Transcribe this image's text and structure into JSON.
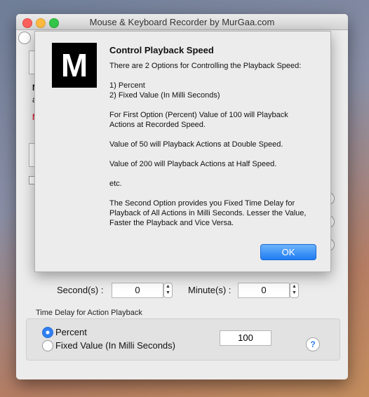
{
  "window": {
    "title": "Mouse & Keyboard Recorder by MurGaa.com"
  },
  "background_fragments": {
    "letter_n": "N",
    "letter_a": "a",
    "letter_n_red": "N"
  },
  "time_row": {
    "seconds_label": "Second(s) :",
    "seconds_value": "0",
    "minutes_label": "Minute(s) :",
    "minutes_value": "0"
  },
  "playback_group": {
    "label": "Time Delay for Action Playback",
    "option_percent": "Percent",
    "option_fixed": "Fixed Value (In Milli Seconds)",
    "selected": "Percent",
    "value": "100",
    "help_label": "?"
  },
  "dialog": {
    "logo_letter": "M",
    "title": "Control Playback Speed",
    "paragraphs": [
      "There are 2 Options for Controlling the Playback Speed:",
      "1) Percent\n2) Fixed Value (In Milli Seconds)",
      "For First Option (Percent) Value of 100 will Playback Actions at Recorded Speed.",
      "Value of 50 will Playback Actions at Double Speed.",
      "Value of 200 will Playback Actions at Half Speed.",
      "etc.",
      "The Second Option provides you Fixed Time Delay for Playback of All Actions in Milli Seconds. Lesser the Value, Faster the Playback and Vice Versa."
    ],
    "ok_label": "OK"
  },
  "colors": {
    "accent": "#1f7cf2",
    "close": "#fc605c",
    "minimize": "#fdbc40",
    "maximize": "#34c84a"
  }
}
